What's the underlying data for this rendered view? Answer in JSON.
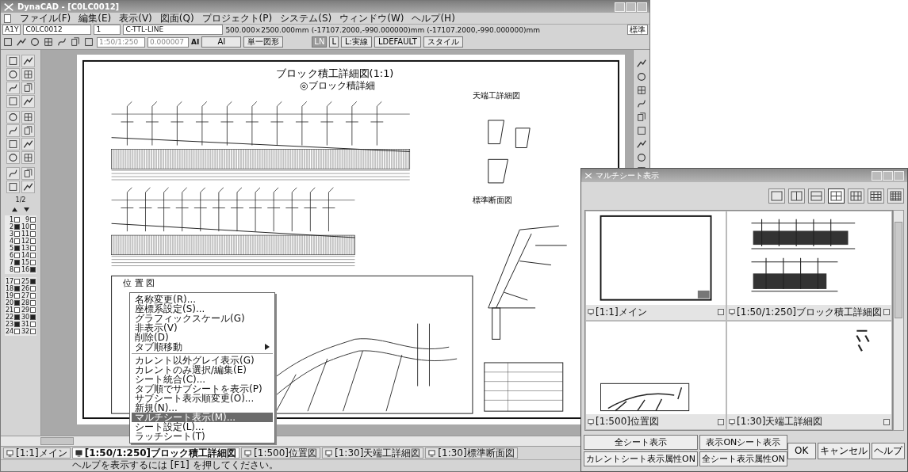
{
  "window": {
    "title": "DynaCAD - [C0LC0012]"
  },
  "menu": [
    "ファイル(F)",
    "編集(E)",
    "表示(V)",
    "図面(Q)",
    "プロジェクト(P)",
    "システム(S)",
    "ウィンドウ(W)",
    "ヘルプ(H)"
  ],
  "info_bar": {
    "sheet_code": "A1Y",
    "drawing_id": "C0LC0012",
    "layer_no": "1",
    "layer_name": "C-TTL-LINE",
    "paper": "500.000×2500.000mm",
    "cursor_1": "(-17107.2000,-990.000000)mm",
    "cursor_2": "(-17107.2000,-990.000000)mm",
    "style": "標準"
  },
  "toolbar": {
    "scale": "1:50/1:250",
    "value": "0.000007",
    "font_label": "AI",
    "font": "AI",
    "mode": "単一図形",
    "linetype_toggle": [
      "LN",
      "L"
    ],
    "linetype": "L:実線",
    "pen": "LDEFAULT",
    "style_button": "スタイル"
  },
  "layer_panel": {
    "page": "1/2",
    "layers": [
      {
        "number": "1",
        "on": false
      },
      {
        "number": "9",
        "on": false
      },
      {
        "number": "2",
        "on": true
      },
      {
        "number": "10",
        "on": false
      },
      {
        "number": "3",
        "on": false
      },
      {
        "number": "11",
        "on": false
      },
      {
        "number": "4",
        "on": false
      },
      {
        "number": "12",
        "on": false
      },
      {
        "number": "5",
        "on": true
      },
      {
        "number": "13",
        "on": false
      },
      {
        "number": "6",
        "on": false
      },
      {
        "number": "14",
        "on": false
      },
      {
        "number": "7",
        "on": true
      },
      {
        "number": "15",
        "on": false
      },
      {
        "number": "8",
        "on": false
      },
      {
        "number": "16",
        "on": true
      },
      {
        "number": "17",
        "on": false
      },
      {
        "number": "25",
        "on": true
      },
      {
        "number": "18",
        "on": true
      },
      {
        "number": "26",
        "on": false
      },
      {
        "number": "19",
        "on": false
      },
      {
        "number": "27",
        "on": false
      },
      {
        "number": "20",
        "on": true
      },
      {
        "number": "28",
        "on": false
      },
      {
        "number": "21",
        "on": false
      },
      {
        "number": "29",
        "on": false
      },
      {
        "number": "22",
        "on": true
      },
      {
        "number": "30",
        "on": true
      },
      {
        "number": "23",
        "on": true
      },
      {
        "number": "31",
        "on": false
      },
      {
        "number": "24",
        "on": false
      },
      {
        "number": "32",
        "on": false
      }
    ]
  },
  "drawing": {
    "title": "ブロック積工詳細図(1:1)",
    "subtitle": "◎ブロック積詳細",
    "detail_title": "天端工詳細図",
    "section_title": "標準断面図",
    "map_title": "位 置 図"
  },
  "context_menu": [
    {
      "kind": "item",
      "label": "名称変更(R)...",
      "selected": false
    },
    {
      "kind": "item",
      "label": "座標系設定(S)...",
      "selected": false
    },
    {
      "kind": "item",
      "label": "グラフィックスケール(G)",
      "selected": false
    },
    {
      "kind": "item",
      "label": "非表示(V)",
      "selected": false
    },
    {
      "kind": "item",
      "label": "削除(D)",
      "selected": false
    },
    {
      "kind": "submenu",
      "label": "タブ順移動",
      "selected": false
    },
    {
      "kind": "separator"
    },
    {
      "kind": "item",
      "label": "カレント以外グレイ表示(G)",
      "selected": false
    },
    {
      "kind": "item",
      "label": "カレントのみ選択/編集(E)",
      "selected": false
    },
    {
      "kind": "item",
      "label": "シート統合(C)...",
      "selected": false
    },
    {
      "kind": "item",
      "label": "タブ順でサブシートを表示(P)",
      "selected": false
    },
    {
      "kind": "item",
      "label": "サブシート表示順変更(O)...",
      "selected": false
    },
    {
      "kind": "item",
      "label": "新規(N)...",
      "selected": false
    },
    {
      "kind": "item",
      "label": "マルチシート表示(M)...",
      "selected": true
    },
    {
      "kind": "item",
      "label": "シート設定(L)...",
      "selected": false
    },
    {
      "kind": "item",
      "label": "ラッチシート(T)",
      "selected": false
    }
  ],
  "sheet_tabs": [
    {
      "label": "[1:1]メイン",
      "selected": false
    },
    {
      "label": "[1:50/1:250]ブロック積工詳細図",
      "selected": true
    },
    {
      "label": "[1:500]位置図",
      "selected": false
    },
    {
      "label": "[1:30]天端工詳細図",
      "selected": false
    },
    {
      "label": "[1:30]標準断面図",
      "selected": false
    }
  ],
  "status_bar": "ヘルプを表示するには [F1] を押してください。",
  "dialog": {
    "title": "マルチシート表示",
    "layouts": [
      {
        "kind": "single",
        "selected": false
      },
      {
        "kind": "columns",
        "selected": false
      },
      {
        "kind": "rows",
        "selected": false
      },
      {
        "kind": "grid4",
        "selected": true
      },
      {
        "kind": "grid6",
        "selected": false
      },
      {
        "kind": "grid8",
        "selected": false
      },
      {
        "kind": "grid9",
        "selected": false
      }
    ],
    "panes": [
      {
        "label": "[1:1]メイン",
        "kind": "frame"
      },
      {
        "label": "[1:50/1:250]ブロック積工詳細図",
        "kind": "profile"
      },
      {
        "label": "[1:500]位置図",
        "kind": "map"
      },
      {
        "label": "[1:30]天端工詳細図",
        "kind": "detail"
      }
    ],
    "left_buttons": [
      "全シート表示",
      "表示ONシート表示",
      "カレントシート表示属性ON",
      "全シート表示属性ON"
    ],
    "right_buttons": [
      "OK",
      "キャンセル",
      "ヘルプ"
    ]
  }
}
